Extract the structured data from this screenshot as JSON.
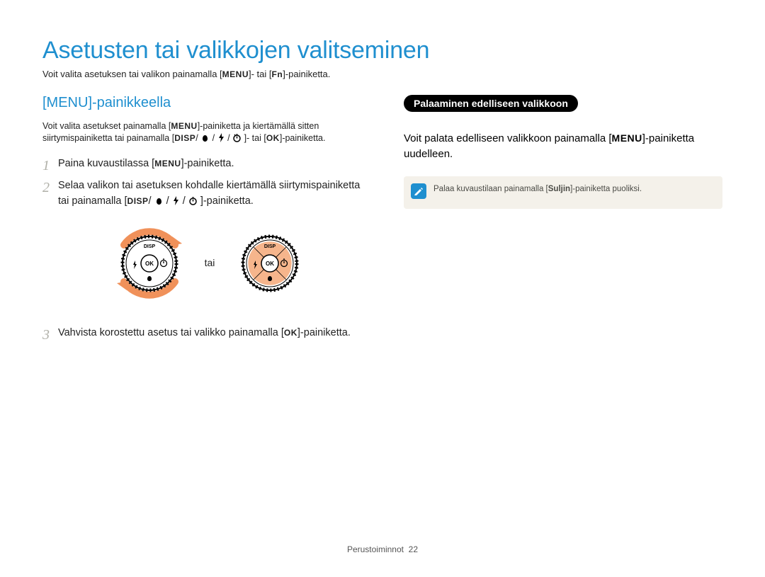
{
  "title": "Asetusten tai valikkojen valitseminen",
  "intro_prefix": "Voit valita asetuksen tai valikon painamalla [",
  "intro_key1": "MENU",
  "intro_mid": "]- tai [",
  "intro_key2": "Fn",
  "intro_suffix": "]-painiketta.",
  "left": {
    "heading": "[MENU]-painikkeella",
    "desc_1a": "Voit valita asetukset painamalla [",
    "desc_1b": "MENU",
    "desc_1c": "]-painiketta ja kiertämällä sitten siirtymispainiketta tai painamalla [",
    "desc_1d": "DISP",
    "desc_1e": "/",
    "desc_1f": "]- tai [",
    "desc_1g": "OK",
    "desc_1h": "]-painiketta.",
    "step1_a": "Paina kuvaustilassa [",
    "step1_b": "MENU",
    "step1_c": "]-painiketta.",
    "step2_a": "Selaa valikon tai asetuksen kohdalle kiertämällä siirtymispainiketta tai painamalla [",
    "step2_b": "DISP",
    "step2_c": "/",
    "step2_d": "]-painiketta.",
    "or": "tai",
    "step3_a": "Vahvista korostettu asetus tai valikko painamalla [",
    "step3_b": "OK",
    "step3_c": "]-painiketta.",
    "dial_labels": {
      "top": "DISP",
      "center": "OK"
    }
  },
  "right": {
    "pill": "Palaaminen edelliseen valikkoon",
    "body_a": "Voit palata edelliseen valikkoon painamalla [",
    "body_b": "MENU",
    "body_c": "]-painiketta uudelleen.",
    "note_a": "Palaa kuvaustilaan painamalla [",
    "note_b": "Suljin",
    "note_c": "]-painiketta puoliksi."
  },
  "footer_label": "Perustoiminnot",
  "footer_page": "22"
}
